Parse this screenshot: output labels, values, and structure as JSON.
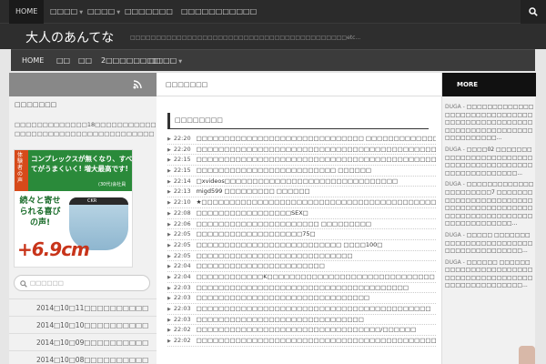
{
  "topnav": {
    "items": [
      {
        "label": "HOME",
        "caret": false
      },
      {
        "label": "□□□□",
        "caret": true
      },
      {
        "label": "□□□□",
        "caret": true
      },
      {
        "label": "□□□□□□□",
        "caret": false
      },
      {
        "label": "□□□□□□□□□□□",
        "caret": false
      }
    ],
    "search_icon": "search-icon"
  },
  "header": {
    "title": "大人のあんてな",
    "description": "□□□□□□□□□□□□□□□□□□□□□□□□□□□□□□□□□□□□□□□□□□etc..."
  },
  "subnav": {
    "items": [
      {
        "label": "HOME",
        "caret": false
      },
      {
        "label": "□□",
        "caret": false
      },
      {
        "label": "□□",
        "caret": false
      },
      {
        "label": "2□□□□□□□□",
        "caret": false
      },
      {
        "label": "□□□□",
        "caret": true
      }
    ]
  },
  "left_sidebar": {
    "rss_icon": "rss-icon",
    "title": "□□□□□□□",
    "text": "□□□□□□□□□□□□□18□□□□□□□□□□□□□□ □□□□□□□□□□□□□□□□□□□□□□□□□",
    "ad": {
      "tag": "体験者の声",
      "headline": "コンプレックスが無くなり、すべてがうまくいく! 増大最高です!",
      "sub": "(30代)会社員",
      "left_text": "続々と寄せられる喜びの声!",
      "big": "+6.9cm",
      "brand": "CKR"
    },
    "search_placeholder": "□□□□□□",
    "archives": [
      "2014□10□11□□□□□□□□□□",
      "2014□10□10□□□□□□□□□□",
      "2014□10□09□□□□□□□□□□",
      "2014□10□08□□□□□□□□□□"
    ]
  },
  "main": {
    "header": "□□□□□□□",
    "section_title": "□□□□□□□□",
    "feed": [
      {
        "time": "22:20",
        "title": "□□□□□□□□□□□□□□□□□□□□□□□□□□□□□□ □□□□□□□□□□□□□□□□□□□□□□□□□□"
      },
      {
        "time": "22:20",
        "title": "□□□□□□□□□□□□□□□□□□□□□□□□□□□□□□□□□□□□□□□□□□□"
      },
      {
        "time": "22:15",
        "title": "□□□□□□□□□□□□□□□□□□□□□□□□□□□□□□□□□□□□□□□□□□□□"
      },
      {
        "time": "22:15",
        "title": "□□□□□□□□□□□□□□□□□□□□□□□□□ □□□□□□"
      },
      {
        "time": "22:14",
        "title": "□xvideos□□□□□□□□□□□□□□□□□□□□□□□□□□□□□□□"
      },
      {
        "time": "22:13",
        "title": "migd599 □□□□□□□□□ □□□□□□"
      },
      {
        "time": "22:10",
        "title": "★□□□□□□□□□□□□□□□□□□□□□□□□□□□□□□□□□□□□□□□□□□□□□□□□"
      },
      {
        "time": "22:08",
        "title": "□□□□□□□□□□□□□□□□□SEX□"
      },
      {
        "time": "22:06",
        "title": "□□□□□□□□□□□□□□□□□□□□□□ □□□□□□□□□"
      },
      {
        "time": "22:05",
        "title": "□□□□□□□□□□□□□□□□□□□75□"
      },
      {
        "time": "22:05",
        "title": "□□□□□□□□□□□□□□□□□□□□□□□□□□ □□□□100□"
      },
      {
        "time": "22:05",
        "title": "□□□□□□□□□□□□□□□□□□□□□□□□□□□□"
      },
      {
        "time": "22:04",
        "title": "□□□□□□□□□□□□□□□□□□□□□□□"
      },
      {
        "time": "22:04",
        "title": "□□□□□□□□□□□□K□□□□□□□□□□□□□□□□□□□□□□□□□□□□□□"
      },
      {
        "time": "22:03",
        "title": "□□□□□□□□□□□□□□□□□□□□□□□□□□□□□□□□□□□□□□"
      },
      {
        "time": "22:03",
        "title": "□□□□□□□□□□□□□□□□□□□□□□□□□□□□□□□"
      },
      {
        "time": "22:03",
        "title": "□□□□□□□□□□□□□□□□□□□□□□□□□□□□□□□□□□□□□□□□□□"
      },
      {
        "time": "22:03",
        "title": "□□□□□□□□□□□□□□□□□□□□□□□□□□□□□□"
      },
      {
        "time": "22:02",
        "title": "□□□□□□□□□□□□□□□□□□□□□□□□□□□□□□□□□/□□□□□□"
      },
      {
        "time": "22:02",
        "title": "□□□□□□□□□□□□□□□□□□□□□□□□□□□□□□□□□□□□□□□□□□□□□□"
      }
    ]
  },
  "right_sidebar": {
    "header": "MORE",
    "items": [
      {
        "source": "DUGA -",
        "title": "□□□□□□□□□□□□□□□□□□□□□□□□□□□□□□□□□□□□□□□□□□□□□□□□□□□□□□□□□□□□□□□□□□□□□□□□□□..."
      },
      {
        "source": "DUGA -",
        "title": "□□□□02 □□□□□□□□□□□□□□□□□□□□□□□□□□□□□□□□□□□□□□□□□□□□□□□□□□□□□□□..."
      },
      {
        "source": "DUGA -",
        "title": "□□□□□□□□□□□□□□□□□□□□□□7 □□□□□□□□□□□□□□□□□□□□□□□□□□□□□□□□□□□□□□□□□□□□□□□□□□□□□□□□□□□□□□□□□□□□□□□..."
      },
      {
        "source": "DUGA -",
        "title": "□□□□□ □□□□□□□□□□□□□□□□□□□□□□□□□□□□□□□□□□□□□□□..."
      },
      {
        "source": "DUGA -",
        "title": "□□□□□□ □□□□□□□□□□□□□□□□□□□□□□□□□□□□□□□□□□□□□□□□□□□□□□□□□□□□□□□..."
      }
    ]
  }
}
